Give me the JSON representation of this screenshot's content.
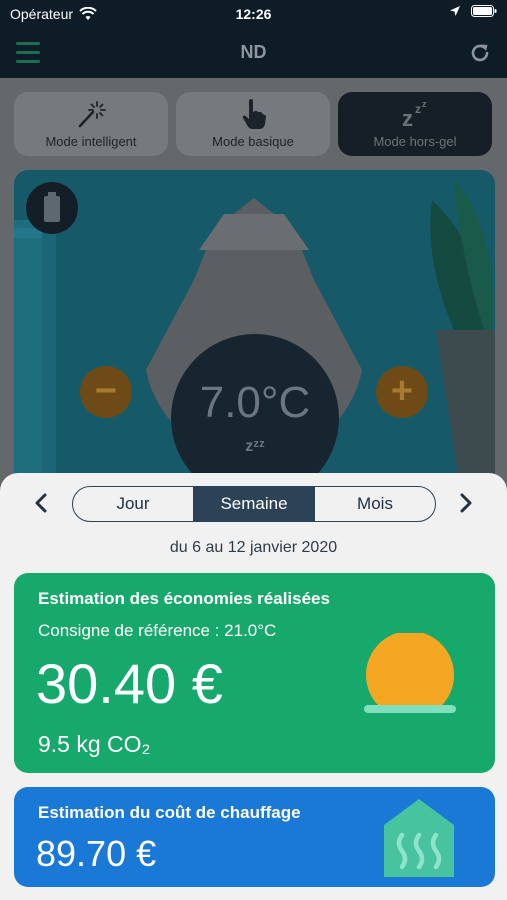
{
  "status_bar": {
    "carrier": "Opérateur",
    "time": "12:26"
  },
  "nav": {
    "title": "ND"
  },
  "modes": [
    {
      "label": "Mode intelligent",
      "icon": "magic-wand-icon"
    },
    {
      "label": "Mode basique",
      "icon": "hand-pointer-icon"
    },
    {
      "label": "Mode hors-gel",
      "icon": "sleep-zzz-icon",
      "active": true
    }
  ],
  "thermostat": {
    "temperature": "7.0°C",
    "minus": "−",
    "plus": "+",
    "mode_symbol": "zᶻᶻ"
  },
  "periods": {
    "tabs": [
      "Jour",
      "Semaine",
      "Mois"
    ],
    "selected": "Semaine",
    "range": "du 6 au 12 janvier 2020"
  },
  "savings": {
    "title": "Estimation des économies réalisées",
    "reference": "Consigne de référence : 21.0°C",
    "amount": "30.40 €",
    "co2": "9.5 kg CO₂"
  },
  "heating_cost": {
    "title": "Estimation du coût de chauffage",
    "amount": "89.70 €"
  },
  "colors": {
    "green_card": "#17a86c",
    "blue_card": "#1a78d6",
    "segment_active": "#2c4257",
    "sun": "#f5a623"
  }
}
